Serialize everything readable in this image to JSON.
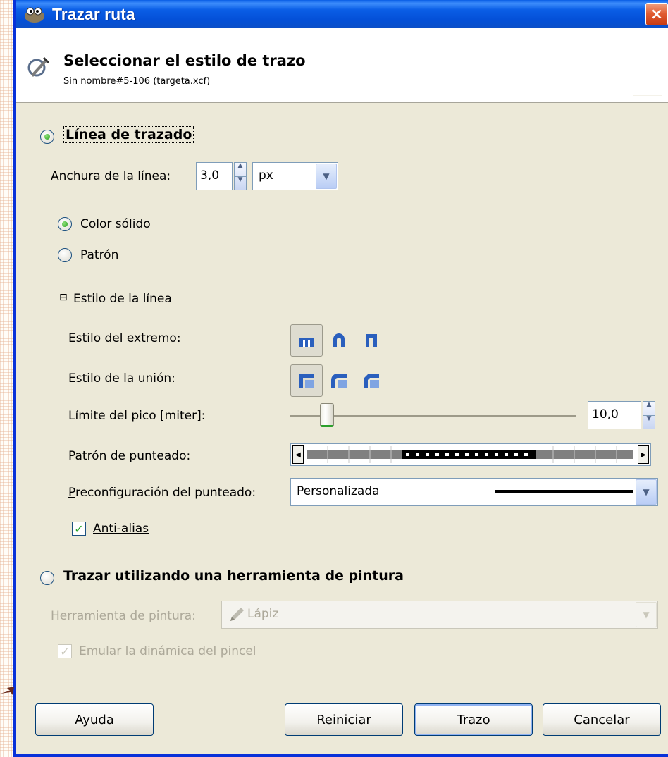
{
  "window": {
    "title": "Trazar ruta",
    "close_label": "×"
  },
  "header": {
    "title": "Seleccionar el estilo de trazo",
    "subtitle": "Sin nombre#5-106 (targeta.xcf)"
  },
  "stroke_line": {
    "radio_label": "Línea de trazado",
    "selected": true,
    "width_label": "Anchura de la línea:",
    "width_value": "3,0",
    "unit_value": "px",
    "fill": {
      "solid_label": "Color sólido",
      "pattern_label": "Patrón",
      "selected": "solid"
    },
    "line_style": {
      "expander_symbol": "⊟",
      "title": "Estilo de la línea",
      "cap_label": "Estilo del extremo:",
      "cap_icons": [
        "cap-butt-icon",
        "cap-round-icon",
        "cap-square-icon"
      ],
      "join_label": "Estilo de la unión:",
      "join_icons": [
        "join-miter-icon",
        "join-round-icon",
        "join-bevel-icon"
      ],
      "miter_label": "Límite del pico [miter]:",
      "miter_value": "10,0",
      "miter_slider_fraction": 0.11,
      "dash_label": "Patrón de punteado:",
      "preset_label": "Preconfiguración del punteado:",
      "preset_value": "Personalizada",
      "antialias_label": "Anti-alias",
      "antialias_checked": true
    }
  },
  "stroke_paint": {
    "radio_label": "Trazar utilizando una herramienta de pintura",
    "selected": false,
    "tool_label": "Herramienta de pintura:",
    "tool_value": "Lápiz",
    "emulate_label": "Emular la dinámica del pincel",
    "emulate_checked": true
  },
  "buttons": {
    "help": "Ayuda",
    "reset": "Reiniciar",
    "stroke": "Trazo",
    "cancel": "Cancelar"
  },
  "colors": {
    "titlebar": "#0a5ee6",
    "dialog_bg": "#ece9d8",
    "check_green": "#21a121",
    "icon_blue": "#2a5fbd"
  }
}
